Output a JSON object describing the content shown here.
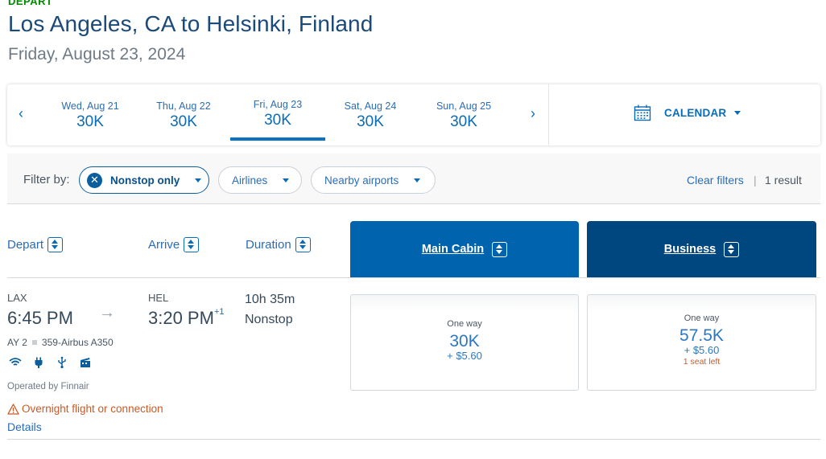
{
  "header": {
    "section_label": "DEPART",
    "route": "Los Angeles, CA to Helsinki, Finland",
    "date": "Friday, August 23, 2024"
  },
  "date_strip": {
    "prev_icon": "chevron-left-icon",
    "next_icon": "chevron-right-icon",
    "prev_glyph": "‹",
    "next_glyph": "›",
    "dates": [
      {
        "label": "Wed, Aug 21",
        "price": "30K",
        "active": false
      },
      {
        "label": "Thu, Aug 22",
        "price": "30K",
        "active": false
      },
      {
        "label": "Fri, Aug 23",
        "price": "30K",
        "active": true
      },
      {
        "label": "Sat, Aug 24",
        "price": "30K",
        "active": false
      },
      {
        "label": "Sun, Aug 25",
        "price": "30K",
        "active": false
      }
    ],
    "calendar_label": "CALENDAR",
    "calendar_icon": "calendar-icon"
  },
  "filters": {
    "label": "Filter by:",
    "pills": [
      {
        "label": "Nonstop only",
        "active": true
      },
      {
        "label": "Airlines",
        "active": false
      },
      {
        "label": "Nearby airports",
        "active": false
      }
    ],
    "clear_label": "Clear filters",
    "separator": "|",
    "result_count": "1 result"
  },
  "columns": {
    "depart": "Depart",
    "arrive": "Arrive",
    "duration": "Duration",
    "main_cabin": "Main Cabin",
    "business": "Business"
  },
  "flight": {
    "origin_code": "LAX",
    "depart_time": "6:45 PM",
    "dest_code": "HEL",
    "arrive_time": "3:20 PM",
    "day_offset": "+1",
    "arrow_glyph": "→",
    "flight_number": "AY 2",
    "aircraft": "359-Airbus A350",
    "duration": "10h 35m",
    "stops": "Nonstop",
    "amenities": [
      "wifi-icon",
      "power-plug-icon",
      "usb-icon",
      "entertainment-icon"
    ],
    "operated_by": "Operated by Finnair",
    "warning": "Overnight flight or connection",
    "details_label": "Details",
    "fares": {
      "main": {
        "trip": "One way",
        "miles": "30K",
        "tax": "+ $5.60",
        "seats": ""
      },
      "business": {
        "trip": "One way",
        "miles": "57.5K",
        "tax": "+ $5.60",
        "seats": "1 seat left"
      }
    }
  },
  "colors": {
    "accent_blue": "#0b6bb7",
    "main_cabin_bg": "#0063ad",
    "business_bg": "#00467f",
    "warning": "#c85a28",
    "depart_green": "#008a00"
  }
}
